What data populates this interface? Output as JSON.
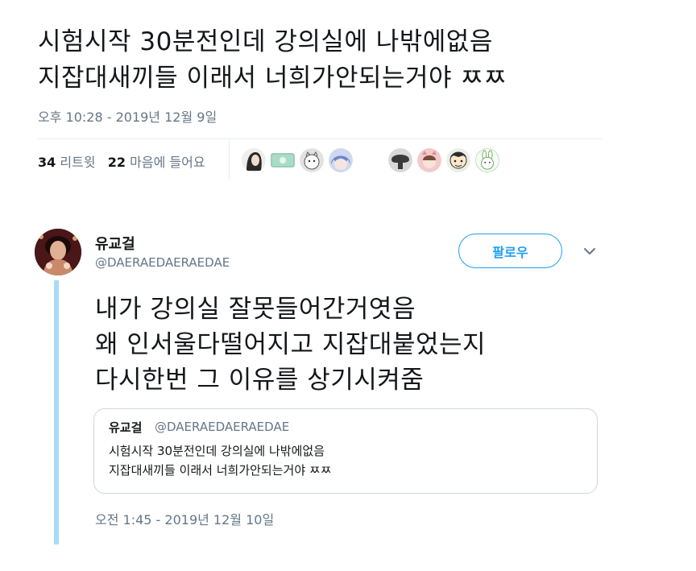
{
  "tweet": {
    "text": "시험시작 30분전인데 강의실에 나밖에없음\n지잡대새끼들 이래서 너희가안되는거야 ㅉㅉ",
    "timestamp": "오후 10:28 - 2019년 12월 9일",
    "retweets_count": "34",
    "retweets_label": " 리트윗",
    "likes_count": "22",
    "likes_label": " 마음에 들어요",
    "liker_avatars": [
      "avatar-1",
      "avatar-2",
      "avatar-3",
      "avatar-4",
      "avatar-5",
      "avatar-6",
      "avatar-7",
      "avatar-8"
    ]
  },
  "reply": {
    "name": "유교걸",
    "handle": "@DAERAEDAERAEDAE",
    "follow_label": "팔로우",
    "text": "내가 강의실 잘못들어간거엿음\n왜 인서울다떨어지고 지잡대붙었는지\n다시한번 그 이유를 상기시켜줌",
    "timestamp": "오전 1:45 - 2019년 12월 10일",
    "quote": {
      "name": "유교걸",
      "handle": "@DAERAEDAERAEDAE",
      "text": "시험시작 30분전인데 강의실에 나밖에없음\n지잡대새끼들 이래서 너희가안되는거야 ㅉㅉ"
    }
  },
  "colors": {
    "accent": "#1da1f2",
    "secondary_text": "#657786",
    "thread_line": "#a7dcf8",
    "border": "#ccd6dd"
  }
}
